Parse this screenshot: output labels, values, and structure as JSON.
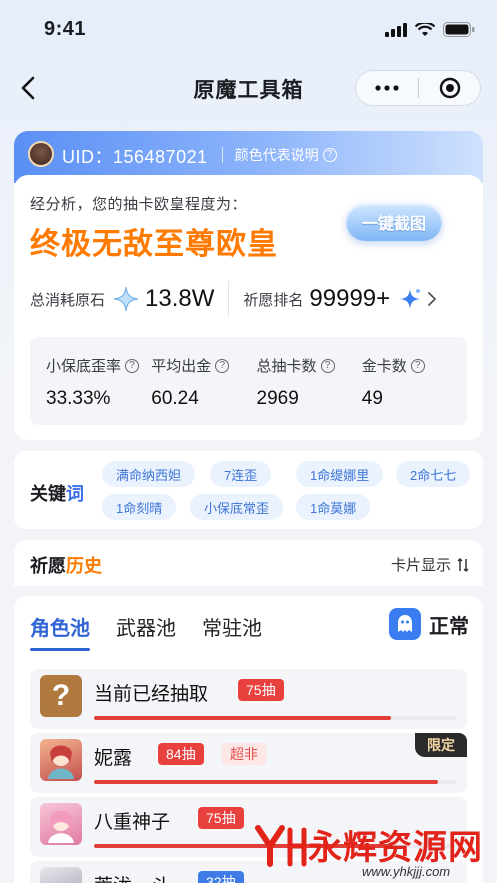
{
  "status": {
    "time": "9:41"
  },
  "nav": {
    "title": "原魔工具箱"
  },
  "uid_bar": {
    "uid": "UID：156487021",
    "color_explain": "颜色代表说明"
  },
  "result": {
    "hint": "经分析，您的抽卡欧皇程度为：",
    "rank_title": "终极无敌至尊欧皇",
    "screenshot_button": "一键截图",
    "total_label": "总消耗原石",
    "total_value": "13.8W",
    "rank_label": "祈愿排名",
    "rank_value": "99999+"
  },
  "kpis": [
    {
      "label": "小保底歪率",
      "value": "33.33%"
    },
    {
      "label": "平均出金",
      "value": "60.24"
    },
    {
      "label": "总抽卡数",
      "value": "2969"
    },
    {
      "label": "金卡数",
      "value": "49"
    }
  ],
  "keywords": {
    "title_a": "关键",
    "title_b": "词",
    "chips": [
      "满命纳西妲",
      "7连歪",
      "1命缇娜里",
      "2命七七",
      "1命刻晴",
      "小保底常歪",
      "1命莫娜"
    ]
  },
  "history": {
    "title_a": "祈愿",
    "title_b": "历史",
    "card_display": "卡片显示"
  },
  "pool": {
    "tabs": [
      "角色池",
      "武器池",
      "常驻池"
    ],
    "mode": "正常",
    "items": [
      {
        "name": "当前已经抽取",
        "count": "75抽",
        "progress": 0.82
      },
      {
        "name": "妮露",
        "count": "84抽",
        "tag": "超非",
        "limited": "限定",
        "progress": 0.95
      },
      {
        "name": "八重神子",
        "count": "75抽",
        "progress": 0.82
      },
      {
        "name": "荒泷一斗",
        "count": "32抽",
        "progress": 0.35
      }
    ]
  },
  "watermark": {
    "text": "永辉资源网",
    "url": "www.yhkjjj.com"
  },
  "colors": {
    "accent": "#2f63d6",
    "orange": "#ff7a00",
    "red": "#e23f3a"
  }
}
